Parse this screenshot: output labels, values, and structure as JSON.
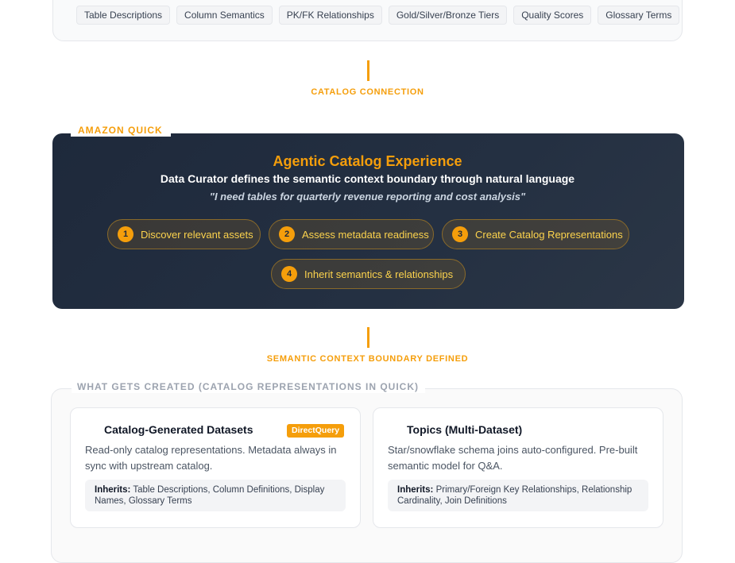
{
  "metadata_tags": [
    "Table Descriptions",
    "Column Semantics",
    "PK/FK Relationships",
    "Gold/Silver/Bronze Tiers",
    "Quality Scores",
    "Glossary Terms"
  ],
  "connectors": {
    "catalog_connection": "CATALOG CONNECTION",
    "boundary_defined": "SEMANTIC CONTEXT BOUNDARY DEFINED"
  },
  "quick": {
    "section_label": "AMAZON QUICK",
    "title": "Agentic Catalog Experience",
    "subtitle": "Data Curator defines the semantic context boundary through natural language",
    "quote": "\"I need tables for quarterly revenue reporting and cost analysis\"",
    "steps": [
      {
        "num": "1",
        "label": "Discover relevant assets"
      },
      {
        "num": "2",
        "label": "Assess metadata readiness"
      },
      {
        "num": "3",
        "label": "Create Catalog Representations"
      },
      {
        "num": "4",
        "label": "Inherit semantics & relationships"
      }
    ]
  },
  "created": {
    "section_label": "WHAT GETS CREATED (CATALOG REPRESENTATIONS IN QUICK)",
    "cards": [
      {
        "title": "Catalog-Generated Datasets",
        "badge": "DirectQuery",
        "description": "Read-only catalog representations. Metadata always in sync with upstream catalog.",
        "inherits_label": "Inherits:",
        "inherits_text": "Table Descriptions, Column Definitions, Display Names, Glossary Terms"
      },
      {
        "title": "Topics (Multi-Dataset)",
        "description": "Star/snowflake schema joins auto-configured. Pre-built semantic model for Q&A.",
        "inherits_label": "Inherits:",
        "inherits_text": "Primary/Foreign Key Relationships, Relationship Cardinality, Join Definitions"
      }
    ]
  },
  "colors": {
    "accent": "#f59e0b",
    "panel_dark": "#1e293b",
    "muted_label": "#9ca3af"
  }
}
